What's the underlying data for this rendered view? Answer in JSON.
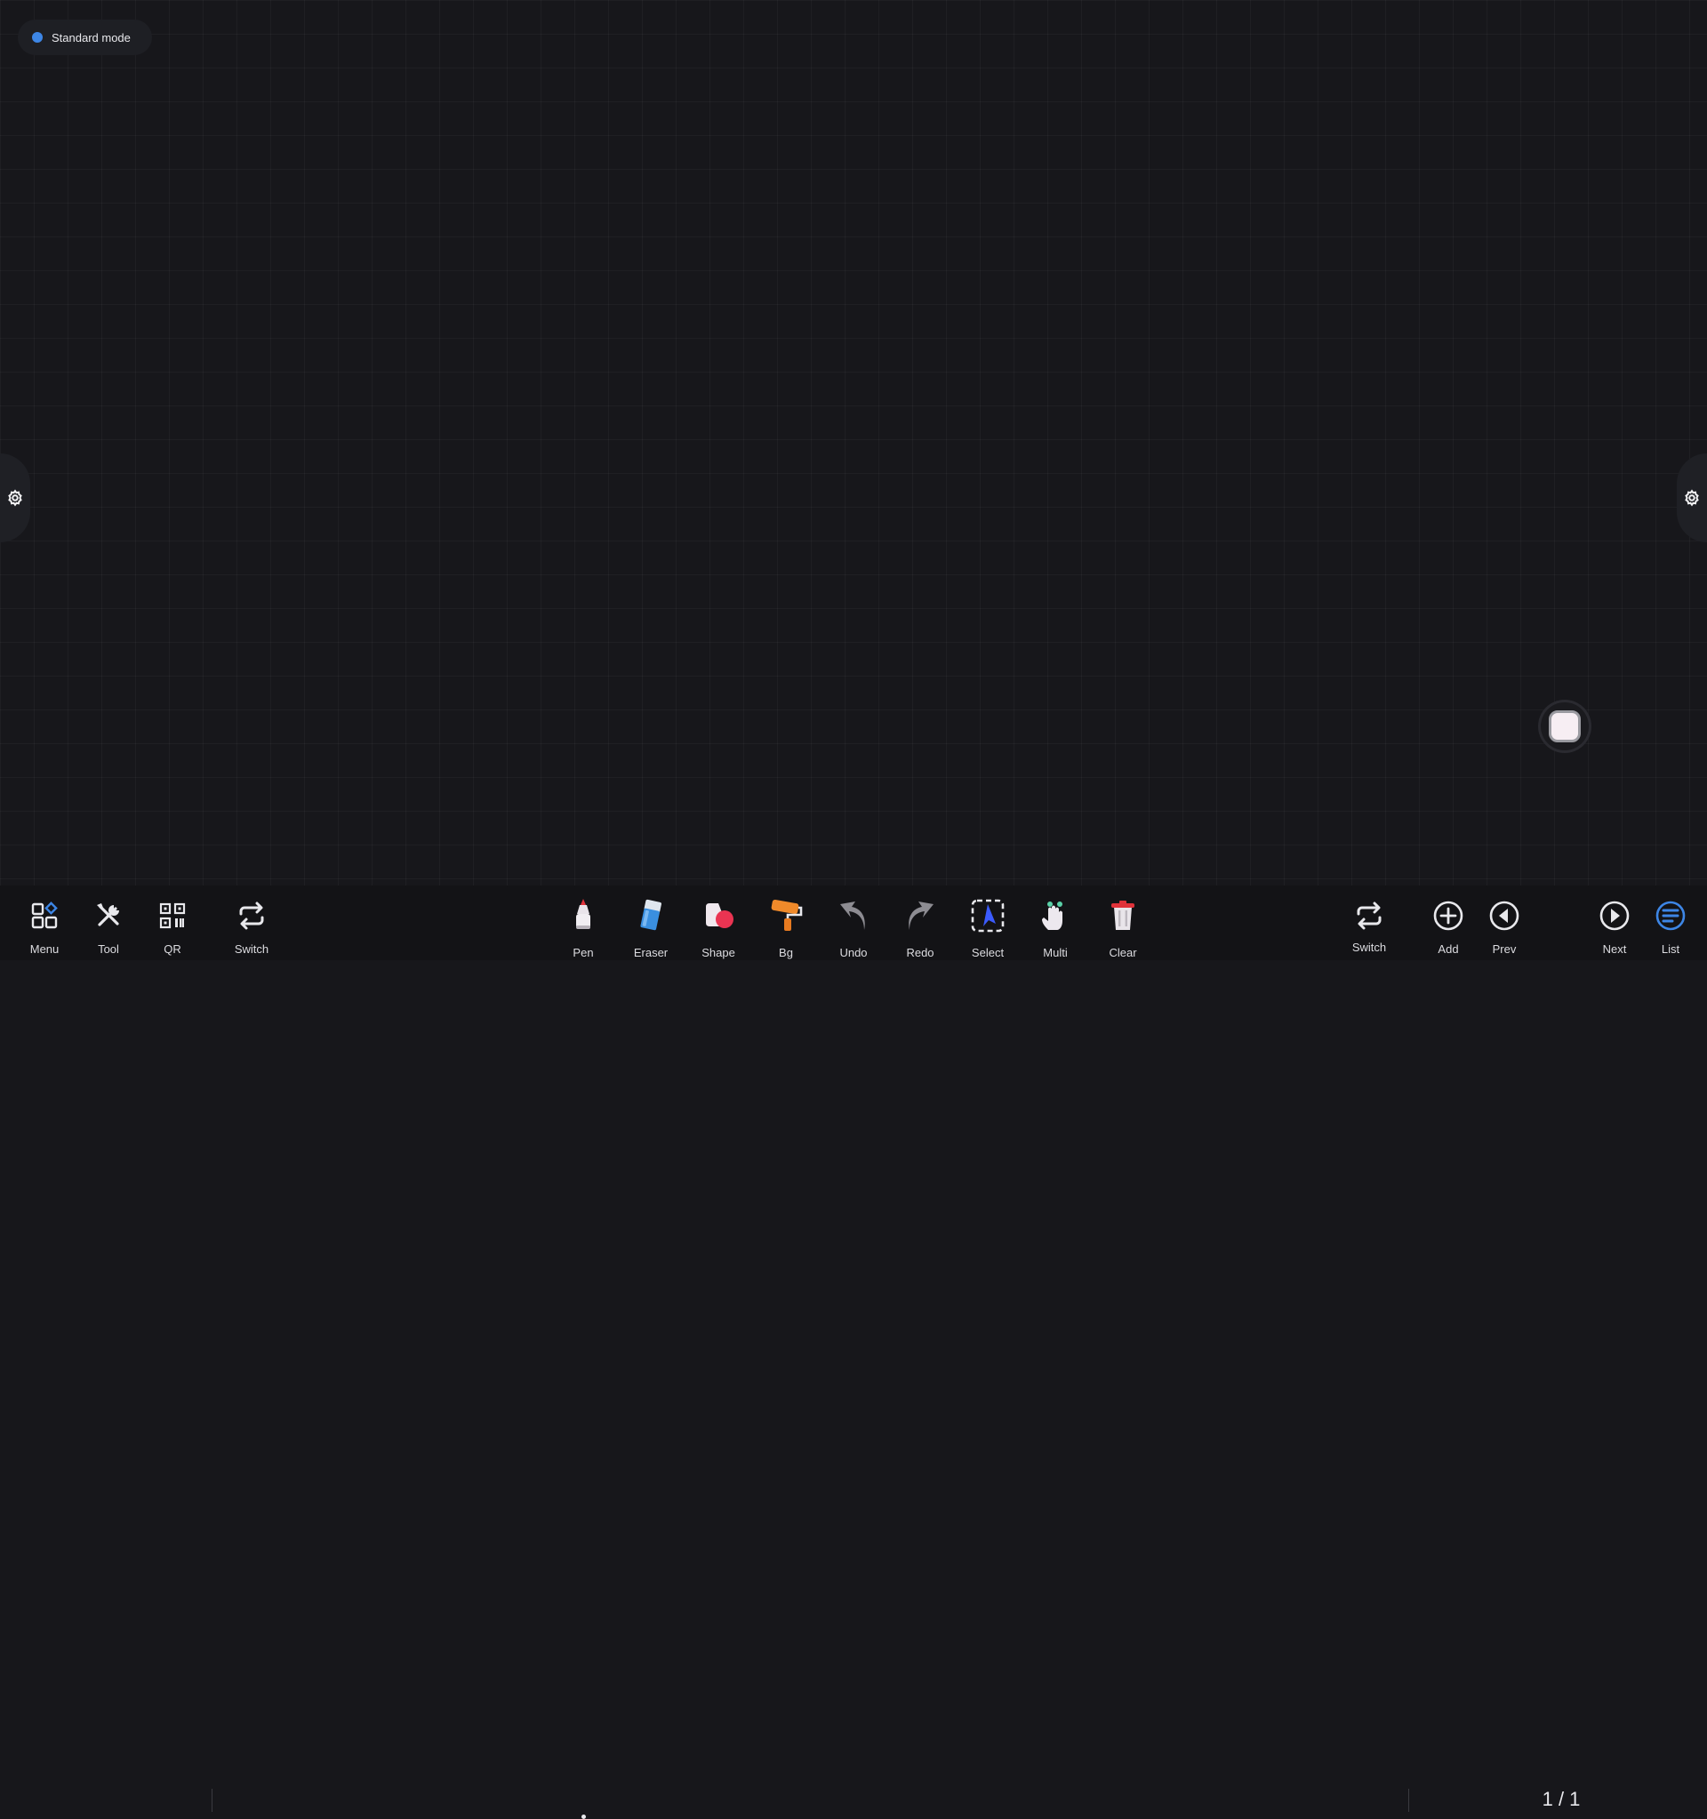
{
  "mode_badge": {
    "label": "Standard mode",
    "dot_color": "#3d86e6"
  },
  "side_tabs": {
    "left_icon": "gear-icon",
    "right_icon": "gear-icon"
  },
  "floating_button": {
    "icon": "rounded-square-icon"
  },
  "toolbar": {
    "left": [
      {
        "id": "menu",
        "label": "Menu",
        "icon": "grid-icon"
      },
      {
        "id": "tool",
        "label": "Tool",
        "icon": "tools-icon"
      },
      {
        "id": "qr",
        "label": "QR",
        "icon": "qr-code-icon"
      },
      {
        "id": "switch",
        "label": "Switch",
        "icon": "switch-arrows-icon"
      }
    ],
    "center": [
      {
        "id": "pen",
        "label": "Pen",
        "icon": "pen-icon"
      },
      {
        "id": "eraser",
        "label": "Eraser",
        "icon": "eraser-icon"
      },
      {
        "id": "shape",
        "label": "Shape",
        "icon": "shape-icon"
      },
      {
        "id": "bg",
        "label": "Bg",
        "icon": "paint-roller-icon"
      },
      {
        "id": "undo",
        "label": "Undo",
        "icon": "undo-arrow-icon"
      },
      {
        "id": "redo",
        "label": "Redo",
        "icon": "redo-arrow-icon"
      },
      {
        "id": "select",
        "label": "Select",
        "icon": "select-cursor-icon"
      },
      {
        "id": "multi",
        "label": "Multi",
        "icon": "multi-touch-hand-icon"
      },
      {
        "id": "clear",
        "label": "Clear",
        "icon": "trash-icon"
      }
    ],
    "right": [
      {
        "id": "switch2",
        "label": "Switch",
        "icon": "switch-arrows-icon"
      },
      {
        "id": "add",
        "label": "Add",
        "icon": "plus-circle-icon"
      },
      {
        "id": "prev",
        "label": "Prev",
        "icon": "prev-circle-icon"
      },
      {
        "id": "next",
        "label": "Next",
        "icon": "next-circle-icon"
      },
      {
        "id": "list",
        "label": "List",
        "icon": "list-icon"
      }
    ],
    "page_indicator": "1 / 1"
  },
  "colors": {
    "background": "#17171b",
    "toolbar": "#131316",
    "accent_blue": "#3d86e6",
    "select_blue": "#3b5bff",
    "clear_red": "#e0323a"
  }
}
